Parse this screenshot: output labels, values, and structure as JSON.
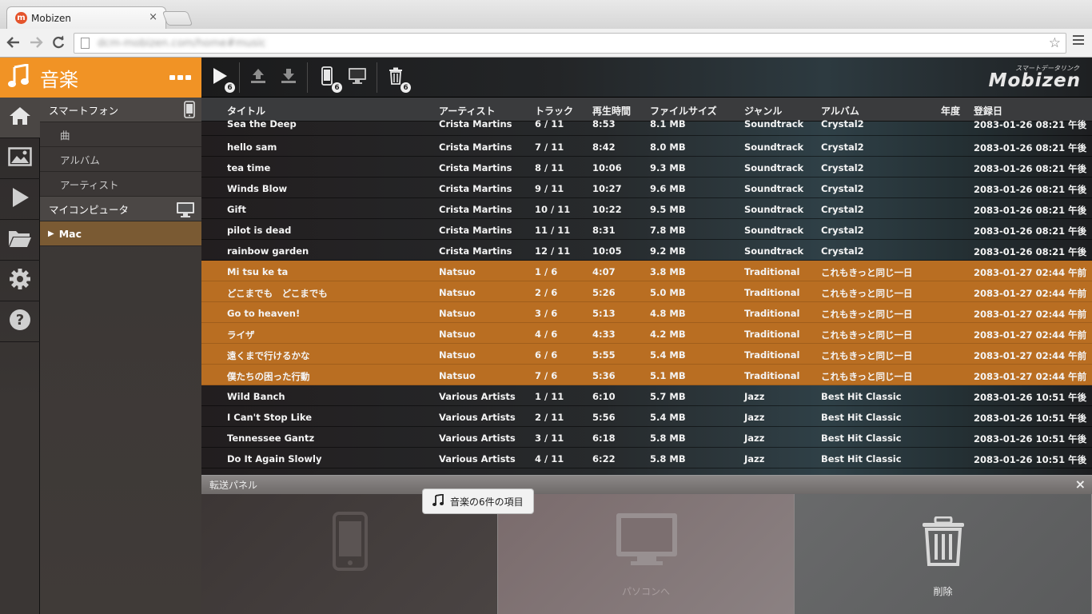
{
  "browser": {
    "tab_title": "Mobizen",
    "tab_favicon": "m",
    "close_glyph": "×",
    "url": "dcm-mobizen.com/home#music"
  },
  "brand": {
    "title": "音楽",
    "logo_sub": "スマートデータリンク",
    "logo": "Mobizen"
  },
  "toolbar": {
    "play_badge": "6",
    "phone_badge": "6",
    "trash_badge": "6"
  },
  "rail": [
    "home-icon",
    "image-icon",
    "video-icon",
    "folder-icon",
    "gear-icon",
    "help-icon"
  ],
  "tree": {
    "smartphone": "スマートフォン",
    "songs": "曲",
    "albums": "アルバム",
    "artists": "アーティスト",
    "my_computer": "マイコンピュータ",
    "mac": "Mac"
  },
  "table": {
    "headers": {
      "title": "タイトル",
      "artist": "アーティスト",
      "track": "トラック",
      "time": "再生時間",
      "size": "ファイルサイズ",
      "genre": "ジャンル",
      "album": "アルバム",
      "year": "年度",
      "date": "登録日"
    },
    "rows": [
      {
        "title": "Sea the Deep",
        "artist": "Crista Martins",
        "track": "6 / 11",
        "time": "8:53",
        "size": "8.1 MB",
        "genre": "Soundtrack",
        "album": "Crystal2",
        "year": "",
        "date": "2083-01-26 08:21 午後",
        "selected": false
      },
      {
        "title": "hello sam",
        "artist": "Crista Martins",
        "track": "7 / 11",
        "time": "8:42",
        "size": "8.0 MB",
        "genre": "Soundtrack",
        "album": "Crystal2",
        "year": "",
        "date": "2083-01-26 08:21 午後",
        "selected": false
      },
      {
        "title": "tea time",
        "artist": "Crista Martins",
        "track": "8 / 11",
        "time": "10:06",
        "size": "9.3 MB",
        "genre": "Soundtrack",
        "album": "Crystal2",
        "year": "",
        "date": "2083-01-26 08:21 午後",
        "selected": false
      },
      {
        "title": "Winds Blow",
        "artist": "Crista Martins",
        "track": "9 / 11",
        "time": "10:27",
        "size": "9.6 MB",
        "genre": "Soundtrack",
        "album": "Crystal2",
        "year": "",
        "date": "2083-01-26 08:21 午後",
        "selected": false
      },
      {
        "title": "Gift",
        "artist": "Crista Martins",
        "track": "10 / 11",
        "time": "10:22",
        "size": "9.5 MB",
        "genre": "Soundtrack",
        "album": "Crystal2",
        "year": "",
        "date": "2083-01-26 08:21 午後",
        "selected": false
      },
      {
        "title": "pilot is dead",
        "artist": "Crista Martins",
        "track": "11 / 11",
        "time": "8:31",
        "size": "7.8 MB",
        "genre": "Soundtrack",
        "album": "Crystal2",
        "year": "",
        "date": "2083-01-26 08:21 午後",
        "selected": false
      },
      {
        "title": "rainbow garden",
        "artist": "Crista Martins",
        "track": "12 / 11",
        "time": "10:05",
        "size": "9.2 MB",
        "genre": "Soundtrack",
        "album": "Crystal2",
        "year": "",
        "date": "2083-01-26 08:21 午後",
        "selected": false
      },
      {
        "title": "Mi tsu ke ta",
        "artist": "Natsuo",
        "track": "1 / 6",
        "time": "4:07",
        "size": "3.8 MB",
        "genre": "Traditional",
        "album": "これもきっと同じ一日",
        "year": "",
        "date": "2083-01-27 02:44 午前",
        "selected": true
      },
      {
        "title": "どこまでも　どこまでも",
        "artist": "Natsuo",
        "track": "2 / 6",
        "time": "5:26",
        "size": "5.0 MB",
        "genre": "Traditional",
        "album": "これもきっと同じ一日",
        "year": "",
        "date": "2083-01-27 02:44 午前",
        "selected": true
      },
      {
        "title": "Go to heaven!",
        "artist": "Natsuo",
        "track": "3 / 6",
        "time": "5:13",
        "size": "4.8 MB",
        "genre": "Traditional",
        "album": "これもきっと同じ一日",
        "year": "",
        "date": "2083-01-27 02:44 午前",
        "selected": true
      },
      {
        "title": "ライザ",
        "artist": "Natsuo",
        "track": "4 / 6",
        "time": "4:33",
        "size": "4.2 MB",
        "genre": "Traditional",
        "album": "これもきっと同じ一日",
        "year": "",
        "date": "2083-01-27 02:44 午前",
        "selected": true
      },
      {
        "title": "遠くまで行けるかな",
        "artist": "Natsuo",
        "track": "6 / 6",
        "time": "5:55",
        "size": "5.4 MB",
        "genre": "Traditional",
        "album": "これもきっと同じ一日",
        "year": "",
        "date": "2083-01-27 02:44 午前",
        "selected": true
      },
      {
        "title": "僕たちの困った行動",
        "artist": "Natsuo",
        "track": "7 / 6",
        "time": "5:36",
        "size": "5.1 MB",
        "genre": "Traditional",
        "album": "これもきっと同じ一日",
        "year": "",
        "date": "2083-01-27 02:44 午前",
        "selected": true
      },
      {
        "title": "Wild Banch",
        "artist": "Various Artists",
        "track": "1 / 11",
        "time": "6:10",
        "size": "5.7 MB",
        "genre": "Jazz",
        "album": "Best Hit Classic",
        "year": "",
        "date": "2083-01-26 10:51 午後",
        "selected": false
      },
      {
        "title": "I Can't Stop Like",
        "artist": "Various Artists",
        "track": "2 / 11",
        "time": "5:56",
        "size": "5.4 MB",
        "genre": "Jazz",
        "album": "Best Hit Classic",
        "year": "",
        "date": "2083-01-26 10:51 午後",
        "selected": false
      },
      {
        "title": "Tennessee Gantz",
        "artist": "Various Artists",
        "track": "3 / 11",
        "time": "6:18",
        "size": "5.8 MB",
        "genre": "Jazz",
        "album": "Best Hit Classic",
        "year": "",
        "date": "2083-01-26 10:51 午後",
        "selected": false
      },
      {
        "title": "Do It Again Slowly",
        "artist": "Various Artists",
        "track": "4 / 11",
        "time": "6:22",
        "size": "5.8 MB",
        "genre": "Jazz",
        "album": "Best Hit Classic",
        "year": "",
        "date": "2083-01-26 10:51 午後",
        "selected": false
      }
    ]
  },
  "transfer": {
    "title": "転送パネル",
    "close": "×",
    "drag_label": "音楽の6件の項目",
    "to_pc": "パソコンへ",
    "delete": "削除"
  },
  "colors": {
    "accent": "#f19325",
    "selection": "#b96e22"
  }
}
